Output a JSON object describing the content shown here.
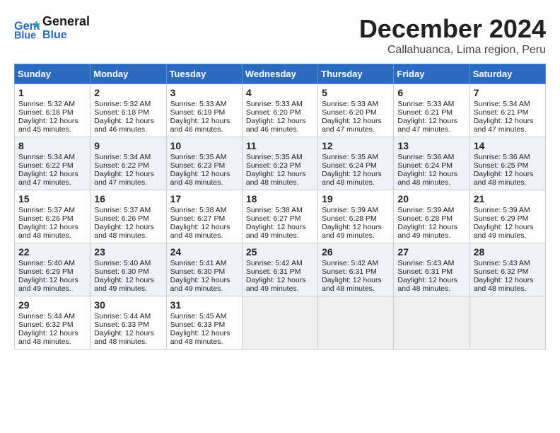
{
  "header": {
    "logo_line1": "General",
    "logo_line2": "Blue",
    "month": "December 2024",
    "location": "Callahuanca, Lima region, Peru"
  },
  "weekdays": [
    "Sunday",
    "Monday",
    "Tuesday",
    "Wednesday",
    "Thursday",
    "Friday",
    "Saturday"
  ],
  "weeks": [
    [
      {
        "day": "1",
        "sunrise": "Sunrise: 5:32 AM",
        "sunset": "Sunset: 6:18 PM",
        "daylight": "Daylight: 12 hours and 45 minutes."
      },
      {
        "day": "2",
        "sunrise": "Sunrise: 5:32 AM",
        "sunset": "Sunset: 6:18 PM",
        "daylight": "Daylight: 12 hours and 46 minutes."
      },
      {
        "day": "3",
        "sunrise": "Sunrise: 5:33 AM",
        "sunset": "Sunset: 6:19 PM",
        "daylight": "Daylight: 12 hours and 46 minutes."
      },
      {
        "day": "4",
        "sunrise": "Sunrise: 5:33 AM",
        "sunset": "Sunset: 6:20 PM",
        "daylight": "Daylight: 12 hours and 46 minutes."
      },
      {
        "day": "5",
        "sunrise": "Sunrise: 5:33 AM",
        "sunset": "Sunset: 6:20 PM",
        "daylight": "Daylight: 12 hours and 47 minutes."
      },
      {
        "day": "6",
        "sunrise": "Sunrise: 5:33 AM",
        "sunset": "Sunset: 6:21 PM",
        "daylight": "Daylight: 12 hours and 47 minutes."
      },
      {
        "day": "7",
        "sunrise": "Sunrise: 5:34 AM",
        "sunset": "Sunset: 6:21 PM",
        "daylight": "Daylight: 12 hours and 47 minutes."
      }
    ],
    [
      {
        "day": "8",
        "sunrise": "Sunrise: 5:34 AM",
        "sunset": "Sunset: 6:22 PM",
        "daylight": "Daylight: 12 hours and 47 minutes."
      },
      {
        "day": "9",
        "sunrise": "Sunrise: 5:34 AM",
        "sunset": "Sunset: 6:22 PM",
        "daylight": "Daylight: 12 hours and 47 minutes."
      },
      {
        "day": "10",
        "sunrise": "Sunrise: 5:35 AM",
        "sunset": "Sunset: 6:23 PM",
        "daylight": "Daylight: 12 hours and 48 minutes."
      },
      {
        "day": "11",
        "sunrise": "Sunrise: 5:35 AM",
        "sunset": "Sunset: 6:23 PM",
        "daylight": "Daylight: 12 hours and 48 minutes."
      },
      {
        "day": "12",
        "sunrise": "Sunrise: 5:35 AM",
        "sunset": "Sunset: 6:24 PM",
        "daylight": "Daylight: 12 hours and 48 minutes."
      },
      {
        "day": "13",
        "sunrise": "Sunrise: 5:36 AM",
        "sunset": "Sunset: 6:24 PM",
        "daylight": "Daylight: 12 hours and 48 minutes."
      },
      {
        "day": "14",
        "sunrise": "Sunrise: 5:36 AM",
        "sunset": "Sunset: 6:25 PM",
        "daylight": "Daylight: 12 hours and 48 minutes."
      }
    ],
    [
      {
        "day": "15",
        "sunrise": "Sunrise: 5:37 AM",
        "sunset": "Sunset: 6:26 PM",
        "daylight": "Daylight: 12 hours and 48 minutes."
      },
      {
        "day": "16",
        "sunrise": "Sunrise: 5:37 AM",
        "sunset": "Sunset: 6:26 PM",
        "daylight": "Daylight: 12 hours and 48 minutes."
      },
      {
        "day": "17",
        "sunrise": "Sunrise: 5:38 AM",
        "sunset": "Sunset: 6:27 PM",
        "daylight": "Daylight: 12 hours and 48 minutes."
      },
      {
        "day": "18",
        "sunrise": "Sunrise: 5:38 AM",
        "sunset": "Sunset: 6:27 PM",
        "daylight": "Daylight: 12 hours and 49 minutes."
      },
      {
        "day": "19",
        "sunrise": "Sunrise: 5:39 AM",
        "sunset": "Sunset: 6:28 PM",
        "daylight": "Daylight: 12 hours and 49 minutes."
      },
      {
        "day": "20",
        "sunrise": "Sunrise: 5:39 AM",
        "sunset": "Sunset: 6:28 PM",
        "daylight": "Daylight: 12 hours and 49 minutes."
      },
      {
        "day": "21",
        "sunrise": "Sunrise: 5:39 AM",
        "sunset": "Sunset: 6:29 PM",
        "daylight": "Daylight: 12 hours and 49 minutes."
      }
    ],
    [
      {
        "day": "22",
        "sunrise": "Sunrise: 5:40 AM",
        "sunset": "Sunset: 6:29 PM",
        "daylight": "Daylight: 12 hours and 49 minutes."
      },
      {
        "day": "23",
        "sunrise": "Sunrise: 5:40 AM",
        "sunset": "Sunset: 6:30 PM",
        "daylight": "Daylight: 12 hours and 49 minutes."
      },
      {
        "day": "24",
        "sunrise": "Sunrise: 5:41 AM",
        "sunset": "Sunset: 6:30 PM",
        "daylight": "Daylight: 12 hours and 49 minutes."
      },
      {
        "day": "25",
        "sunrise": "Sunrise: 5:42 AM",
        "sunset": "Sunset: 6:31 PM",
        "daylight": "Daylight: 12 hours and 49 minutes."
      },
      {
        "day": "26",
        "sunrise": "Sunrise: 5:42 AM",
        "sunset": "Sunset: 6:31 PM",
        "daylight": "Daylight: 12 hours and 48 minutes."
      },
      {
        "day": "27",
        "sunrise": "Sunrise: 5:43 AM",
        "sunset": "Sunset: 6:31 PM",
        "daylight": "Daylight: 12 hours and 48 minutes."
      },
      {
        "day": "28",
        "sunrise": "Sunrise: 5:43 AM",
        "sunset": "Sunset: 6:32 PM",
        "daylight": "Daylight: 12 hours and 48 minutes."
      }
    ],
    [
      {
        "day": "29",
        "sunrise": "Sunrise: 5:44 AM",
        "sunset": "Sunset: 6:32 PM",
        "daylight": "Daylight: 12 hours and 48 minutes."
      },
      {
        "day": "30",
        "sunrise": "Sunrise: 5:44 AM",
        "sunset": "Sunset: 6:33 PM",
        "daylight": "Daylight: 12 hours and 48 minutes."
      },
      {
        "day": "31",
        "sunrise": "Sunrise: 5:45 AM",
        "sunset": "Sunset: 6:33 PM",
        "daylight": "Daylight: 12 hours and 48 minutes."
      },
      null,
      null,
      null,
      null
    ]
  ]
}
